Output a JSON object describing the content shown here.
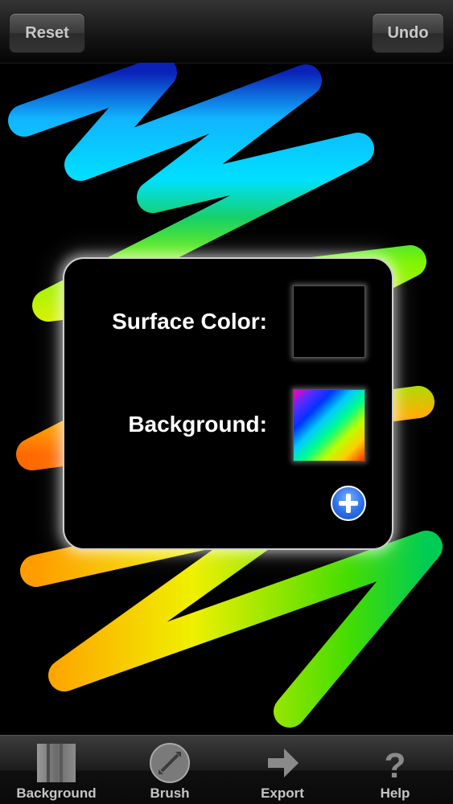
{
  "toolbar": {
    "reset_label": "Reset",
    "undo_label": "Undo"
  },
  "dialog": {
    "surface_color_label": "Surface Color:",
    "background_label": "Background:"
  },
  "tabs": [
    {
      "label": "Background",
      "icon": "background-icon"
    },
    {
      "label": "Brush",
      "icon": "brush-icon"
    },
    {
      "label": "Export",
      "icon": "export-icon"
    },
    {
      "label": "Help",
      "icon": "help-icon"
    }
  ],
  "colors": {
    "surface": "#000000",
    "accent_blue": "#2b6fe8"
  }
}
